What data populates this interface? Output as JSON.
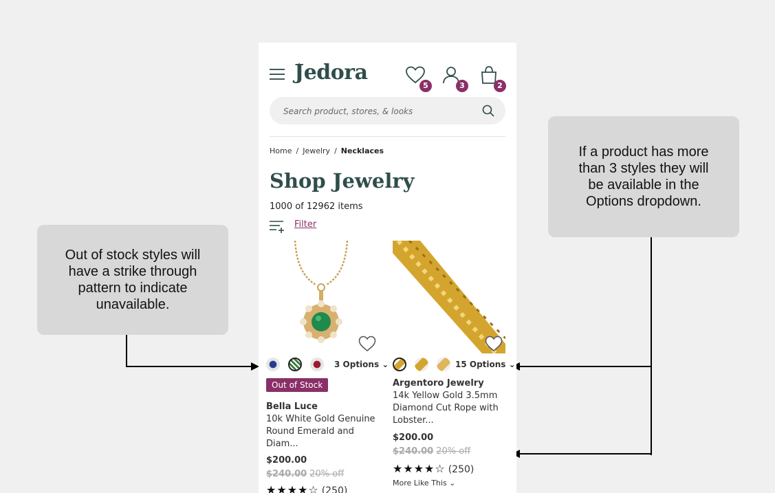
{
  "annotations": {
    "left": "Out of stock styles will have a strike through pattern to indicate unavailable.",
    "right": "If a product has more than 3 styles they will be available in the Options dropdown."
  },
  "header": {
    "logo": "Jedora",
    "wishlist_count": "5",
    "account_count": "3",
    "cart_count": "2"
  },
  "search": {
    "placeholder": "Search product, stores, & looks"
  },
  "breadcrumb": {
    "home": "Home",
    "sep": "/",
    "jewelry": "Jewelry",
    "current": "Necklaces"
  },
  "page": {
    "title": "Shop Jewelry",
    "count": "1000 of 12962 items",
    "filter_label": "Filter"
  },
  "products": [
    {
      "options_label": "3 Options",
      "badge": "Out of Stock",
      "brand": "Bella Luce",
      "name": "10k White Gold Genuine Round Emerald and Diam...",
      "price": "$200.00",
      "was_price": "$240.00",
      "discount": "20% off",
      "rating_count": "(250)"
    },
    {
      "options_label": "15 Options",
      "brand": "Argentoro Jewelry",
      "name": "14k Yellow Gold 3.5mm Diamond Cut Rope with Lobster...",
      "price": "$200.00",
      "was_price": "$240.00",
      "discount": "20% off",
      "rating_count": "(250)",
      "more_label": "More Like This"
    }
  ],
  "colors": {
    "brand": "#2f4e4b",
    "accent": "#8a2f67",
    "callout": "#d8d8d8"
  }
}
